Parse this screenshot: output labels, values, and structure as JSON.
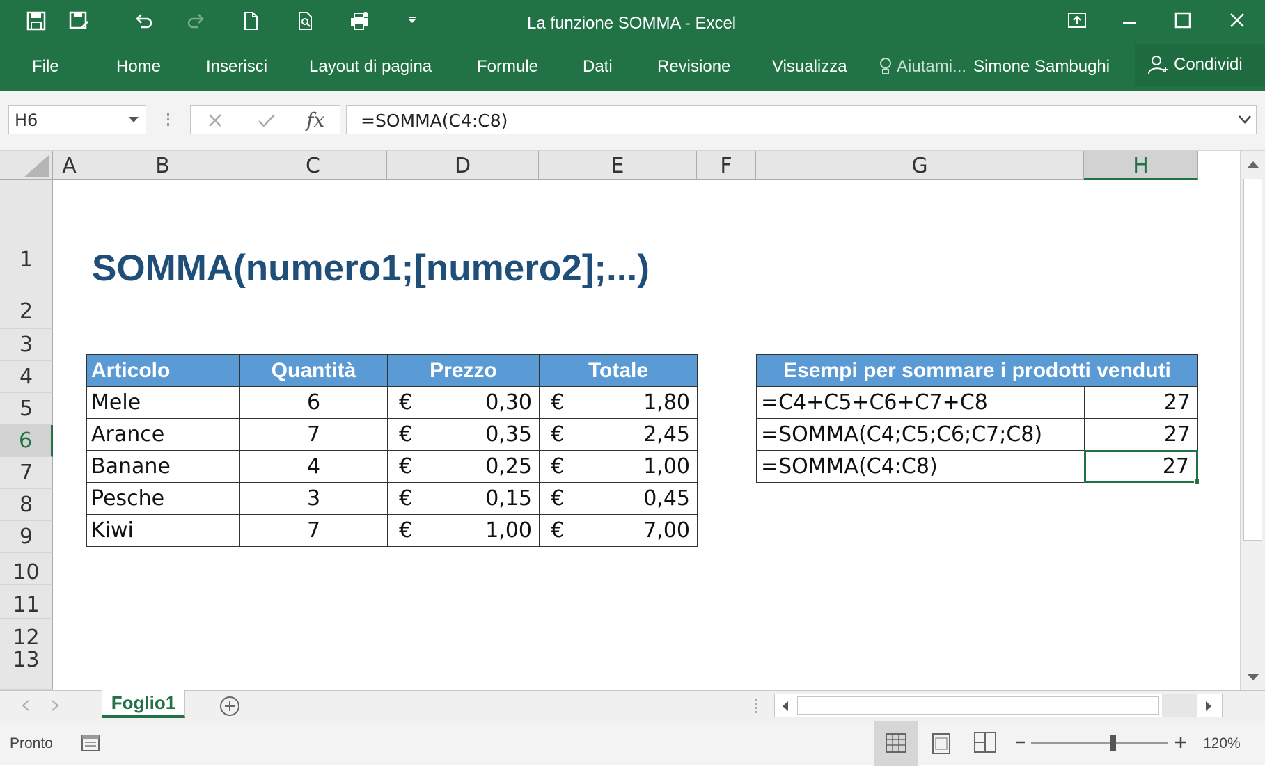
{
  "window": {
    "title": "La funzione SOMMA - Excel"
  },
  "ribbon": {
    "tabs": [
      "File",
      "Home",
      "Inserisci",
      "Layout di pagina",
      "Formule",
      "Dati",
      "Revisione",
      "Visualizza"
    ],
    "tell_me": "Aiutami...",
    "user": "Simone Sambughi",
    "share": "Condividi"
  },
  "formula_bar": {
    "name_box": "H6",
    "fx_label": "fx",
    "formula": "=SOMMA(C4:C8)"
  },
  "columns": [
    "A",
    "B",
    "C",
    "D",
    "E",
    "F",
    "G",
    "H"
  ],
  "rows": [
    "1",
    "2",
    "3",
    "4",
    "5",
    "6",
    "7",
    "8",
    "9",
    "10",
    "11",
    "12",
    "13"
  ],
  "sheet": {
    "title": "SOMMA(numero1;[numero2];...)",
    "table": {
      "headers": [
        "Articolo",
        "Quantità",
        "Prezzo",
        "Totale"
      ],
      "currency": "€",
      "rows": [
        {
          "articolo": "Mele",
          "quantita": "6",
          "prezzo": "0,30",
          "totale": "1,80"
        },
        {
          "articolo": "Arance",
          "quantita": "7",
          "prezzo": "0,35",
          "totale": "2,45"
        },
        {
          "articolo": "Banane",
          "quantita": "4",
          "prezzo": "0,25",
          "totale": "1,00"
        },
        {
          "articolo": "Pesche",
          "quantita": "3",
          "prezzo": "0,15",
          "totale": "0,45"
        },
        {
          "articolo": "Kiwi",
          "quantita": "7",
          "prezzo": "1,00",
          "totale": "7,00"
        }
      ]
    },
    "examples": {
      "header": "Esempi per sommare i prodotti venduti",
      "rows": [
        {
          "formula": "=C4+C5+C6+C7+C8",
          "result": "27"
        },
        {
          "formula": "=SOMMA(C4;C5;C6;C7;C8)",
          "result": "27"
        },
        {
          "formula": "=SOMMA(C4:C8)",
          "result": "27"
        }
      ]
    }
  },
  "tabs": {
    "active": "Foglio1"
  },
  "status": {
    "text": "Pronto",
    "zoom": "120%",
    "zoom_level": 0.6
  },
  "colors": {
    "brand": "#217346",
    "table_header": "#5b9bd5",
    "title": "#1f4e79"
  }
}
